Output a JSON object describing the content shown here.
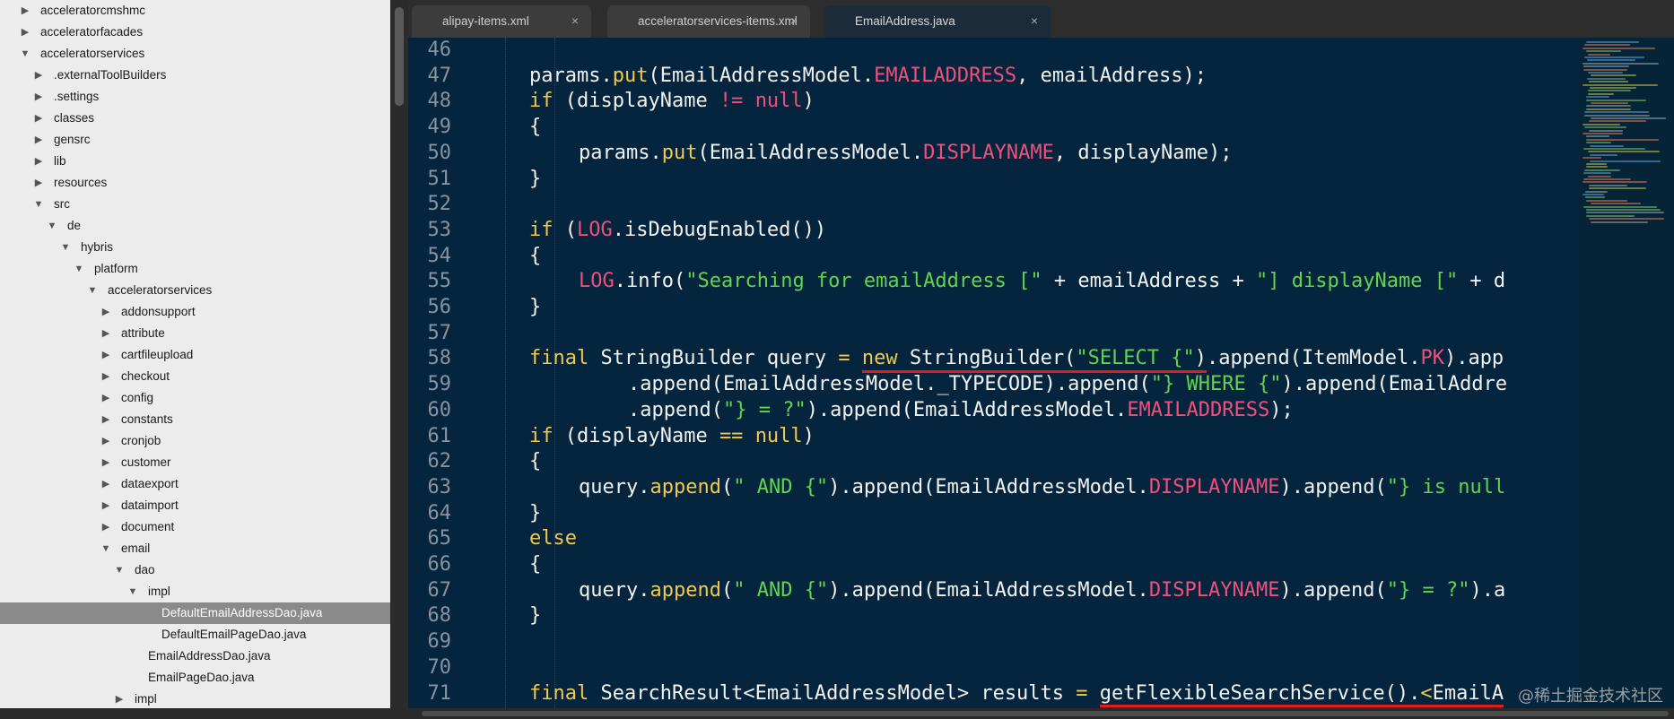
{
  "sidebar": {
    "items": [
      {
        "label": "acceleratorcmshmc",
        "depth": 0,
        "arrow": "collapsed"
      },
      {
        "label": "acceleratorfacades",
        "depth": 0,
        "arrow": "collapsed"
      },
      {
        "label": "acceleratorservices",
        "depth": 0,
        "arrow": "expanded"
      },
      {
        "label": ".externalToolBuilders",
        "depth": 1,
        "arrow": "collapsed"
      },
      {
        "label": ".settings",
        "depth": 1,
        "arrow": "collapsed"
      },
      {
        "label": "classes",
        "depth": 1,
        "arrow": "collapsed"
      },
      {
        "label": "gensrc",
        "depth": 1,
        "arrow": "collapsed"
      },
      {
        "label": "lib",
        "depth": 1,
        "arrow": "collapsed"
      },
      {
        "label": "resources",
        "depth": 1,
        "arrow": "collapsed"
      },
      {
        "label": "src",
        "depth": 1,
        "arrow": "expanded"
      },
      {
        "label": "de",
        "depth": 2,
        "arrow": "expanded"
      },
      {
        "label": "hybris",
        "depth": 3,
        "arrow": "expanded"
      },
      {
        "label": "platform",
        "depth": 4,
        "arrow": "expanded"
      },
      {
        "label": "acceleratorservices",
        "depth": 5,
        "arrow": "expanded"
      },
      {
        "label": "addonsupport",
        "depth": 6,
        "arrow": "collapsed"
      },
      {
        "label": "attribute",
        "depth": 6,
        "arrow": "collapsed"
      },
      {
        "label": "cartfileupload",
        "depth": 6,
        "arrow": "collapsed"
      },
      {
        "label": "checkout",
        "depth": 6,
        "arrow": "collapsed"
      },
      {
        "label": "config",
        "depth": 6,
        "arrow": "collapsed"
      },
      {
        "label": "constants",
        "depth": 6,
        "arrow": "collapsed"
      },
      {
        "label": "cronjob",
        "depth": 6,
        "arrow": "collapsed"
      },
      {
        "label": "customer",
        "depth": 6,
        "arrow": "collapsed"
      },
      {
        "label": "dataexport",
        "depth": 6,
        "arrow": "collapsed"
      },
      {
        "label": "dataimport",
        "depth": 6,
        "arrow": "collapsed"
      },
      {
        "label": "document",
        "depth": 6,
        "arrow": "collapsed"
      },
      {
        "label": "email",
        "depth": 6,
        "arrow": "expanded"
      },
      {
        "label": "dao",
        "depth": 7,
        "arrow": "expanded"
      },
      {
        "label": "impl",
        "depth": 8,
        "arrow": "expanded"
      },
      {
        "label": "DefaultEmailAddressDao.java",
        "depth": 9,
        "arrow": "none",
        "selected": true
      },
      {
        "label": "DefaultEmailPageDao.java",
        "depth": 9,
        "arrow": "none"
      },
      {
        "label": "EmailAddressDao.java",
        "depth": 8,
        "arrow": "none"
      },
      {
        "label": "EmailPageDao.java",
        "depth": 8,
        "arrow": "none"
      },
      {
        "label": "impl",
        "depth": 7,
        "arrow": "collapsed"
      }
    ]
  },
  "tabs": [
    {
      "label": "alipay-items.xml",
      "close": "×",
      "active": false
    },
    {
      "label": "acceleratorservices-items.xml",
      "close": "×",
      "active": false
    },
    {
      "label": "EmailAddress.java",
      "close": "×",
      "active": true
    }
  ],
  "editor": {
    "lines": [
      {
        "num": "46",
        "indent": 0,
        "tokens": []
      },
      {
        "num": "47",
        "indent": 2,
        "tokens": [
          [
            "p",
            "params."
          ],
          [
            "k",
            "put"
          ],
          [
            "p",
            "(EmailAddressModel."
          ],
          [
            "c",
            "EMAILADDRESS"
          ],
          [
            "p",
            ", emailAddress);"
          ]
        ]
      },
      {
        "num": "48",
        "indent": 2,
        "tokens": [
          [
            "k",
            "if"
          ],
          [
            "p",
            " (displayName "
          ],
          [
            "c",
            "!="
          ],
          [
            "p",
            " "
          ],
          [
            "c",
            "null"
          ],
          [
            "p",
            ")"
          ]
        ]
      },
      {
        "num": "49",
        "indent": 2,
        "tokens": [
          [
            "p",
            "{"
          ]
        ]
      },
      {
        "num": "50",
        "indent": 3,
        "tokens": [
          [
            "p",
            "params."
          ],
          [
            "k",
            "put"
          ],
          [
            "p",
            "(EmailAddressModel."
          ],
          [
            "c",
            "DISPLAYNAME"
          ],
          [
            "p",
            ", displayName);"
          ]
        ]
      },
      {
        "num": "51",
        "indent": 2,
        "tokens": [
          [
            "p",
            "}"
          ]
        ]
      },
      {
        "num": "52",
        "indent": 0,
        "tokens": []
      },
      {
        "num": "53",
        "indent": 2,
        "tokens": [
          [
            "k",
            "if"
          ],
          [
            "p",
            " ("
          ],
          [
            "c",
            "LOG"
          ],
          [
            "p",
            ".isDebugEnabled())"
          ]
        ]
      },
      {
        "num": "54",
        "indent": 2,
        "tokens": [
          [
            "p",
            "{"
          ]
        ]
      },
      {
        "num": "55",
        "indent": 3,
        "tokens": [
          [
            "c",
            "LOG"
          ],
          [
            "p",
            ".info("
          ],
          [
            "s",
            "\"Searching for emailAddress [\""
          ],
          [
            "p",
            " + emailAddress + "
          ],
          [
            "s",
            "\"] displayName [\""
          ],
          [
            "p",
            " + d"
          ]
        ]
      },
      {
        "num": "56",
        "indent": 2,
        "tokens": [
          [
            "p",
            "}"
          ]
        ]
      },
      {
        "num": "57",
        "indent": 0,
        "tokens": []
      },
      {
        "num": "58",
        "indent": 2,
        "tokens": [
          [
            "k",
            "final"
          ],
          [
            "p",
            " StringBuilder query "
          ],
          [
            "k",
            "="
          ],
          [
            "p",
            " "
          ],
          [
            "k",
            "new"
          ],
          [
            "p",
            " StringBuilder("
          ],
          [
            "s",
            "\"SELECT {\""
          ],
          [
            "p",
            ").append(ItemModel."
          ],
          [
            "c",
            "PK"
          ],
          [
            "p",
            ").app"
          ]
        ]
      },
      {
        "num": "59",
        "indent": 4,
        "tokens": [
          [
            "p",
            ".append(EmailAddressModel._TYPECODE).append("
          ],
          [
            "s",
            "\"} WHERE {\""
          ],
          [
            "p",
            ").append(EmailAddre"
          ]
        ]
      },
      {
        "num": "60",
        "indent": 4,
        "tokens": [
          [
            "p",
            ".append("
          ],
          [
            "s",
            "\"} = ?\""
          ],
          [
            "p",
            ").append(EmailAddressModel."
          ],
          [
            "c",
            "EMAILADDRESS"
          ],
          [
            "p",
            ");"
          ]
        ]
      },
      {
        "num": "61",
        "indent": 2,
        "tokens": [
          [
            "k",
            "if"
          ],
          [
            "p",
            " (displayName "
          ],
          [
            "k",
            "=="
          ],
          [
            "p",
            " "
          ],
          [
            "k",
            "null"
          ],
          [
            "p",
            ")"
          ]
        ]
      },
      {
        "num": "62",
        "indent": 2,
        "tokens": [
          [
            "p",
            "{"
          ]
        ]
      },
      {
        "num": "63",
        "indent": 3,
        "tokens": [
          [
            "p",
            "query."
          ],
          [
            "k",
            "append"
          ],
          [
            "p",
            "("
          ],
          [
            "s",
            "\" AND {\""
          ],
          [
            "p",
            ").append(EmailAddressModel."
          ],
          [
            "c",
            "DISPLAYNAME"
          ],
          [
            "p",
            ").append("
          ],
          [
            "s",
            "\"} is null"
          ]
        ]
      },
      {
        "num": "64",
        "indent": 2,
        "tokens": [
          [
            "p",
            "}"
          ]
        ]
      },
      {
        "num": "65",
        "indent": 2,
        "tokens": [
          [
            "k",
            "else"
          ]
        ]
      },
      {
        "num": "66",
        "indent": 2,
        "tokens": [
          [
            "p",
            "{"
          ]
        ]
      },
      {
        "num": "67",
        "indent": 3,
        "tokens": [
          [
            "p",
            "query."
          ],
          [
            "k",
            "append"
          ],
          [
            "p",
            "("
          ],
          [
            "s",
            "\" AND {\""
          ],
          [
            "p",
            ").append(EmailAddressModel."
          ],
          [
            "c",
            "DISPLAYNAME"
          ],
          [
            "p",
            ").append("
          ],
          [
            "s",
            "\"} = ?\""
          ],
          [
            "p",
            ").a"
          ]
        ]
      },
      {
        "num": "68",
        "indent": 2,
        "tokens": [
          [
            "p",
            "}"
          ]
        ]
      },
      {
        "num": "69",
        "indent": 0,
        "tokens": []
      },
      {
        "num": "70",
        "indent": 0,
        "tokens": []
      },
      {
        "num": "71",
        "indent": 2,
        "tokens": [
          [
            "k",
            "final"
          ],
          [
            "p",
            " SearchResult<EmailAddressModel> results "
          ],
          [
            "k",
            "="
          ],
          [
            "p",
            " getFlexibleSearchService()."
          ],
          [
            "k",
            "<"
          ],
          [
            "p",
            "EmailA"
          ]
        ]
      }
    ],
    "underlined": [
      {
        "line": "58",
        "text": "new StringBuilder(\"SELECT {\")"
      },
      {
        "line": "71",
        "text": "getFlexibleSearchService().<EmailA"
      }
    ]
  },
  "colors": {
    "editor_bg": "#04253d",
    "keyword": "#f2c94c",
    "string": "#62d44f",
    "constant": "#f0507b",
    "underline": "#e21b1b",
    "selected_row": "#8a8a8a"
  },
  "watermark": "@稀土掘金技术社区"
}
